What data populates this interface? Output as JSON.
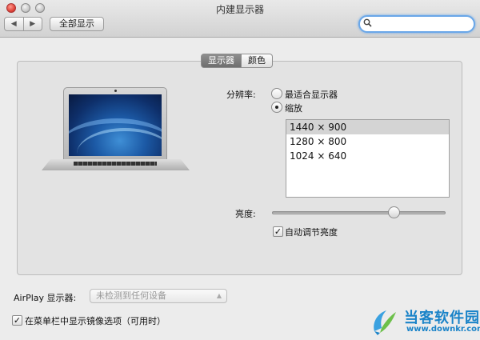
{
  "window": {
    "title": "内建显示器"
  },
  "toolbar": {
    "back_glyph": "◀",
    "forward_glyph": "▶",
    "show_all_label": "全部显示",
    "search_value": "",
    "search_icon": "search-icon"
  },
  "tabs": [
    {
      "label": "显示器",
      "active": true
    },
    {
      "label": "颜色",
      "active": false
    }
  ],
  "display": {
    "resolution_label": "分辨率:",
    "options": [
      {
        "label": "最适合显示器",
        "selected": false
      },
      {
        "label": "缩放",
        "selected": true
      }
    ],
    "resolutions": [
      {
        "label": "1440 × 900",
        "selected": true
      },
      {
        "label": "1280 × 800",
        "selected": false
      },
      {
        "label": "1024 × 640",
        "selected": false
      }
    ],
    "brightness_label": "亮度:",
    "brightness_level": 0.72,
    "auto_brightness_label": "自动调节亮度",
    "auto_brightness_checked": true
  },
  "airplay": {
    "label": "AirPlay 显示器:",
    "selected": "未检测到任何设备",
    "mirror_label": "在菜单栏中显示镜像选项（可用时）",
    "mirror_checked": true
  },
  "watermark": {
    "text": "当客软件园",
    "url": "www.downkr.com"
  },
  "colors": {
    "search_focus": "#6aa7e8",
    "watermark": "#1a83c8"
  }
}
